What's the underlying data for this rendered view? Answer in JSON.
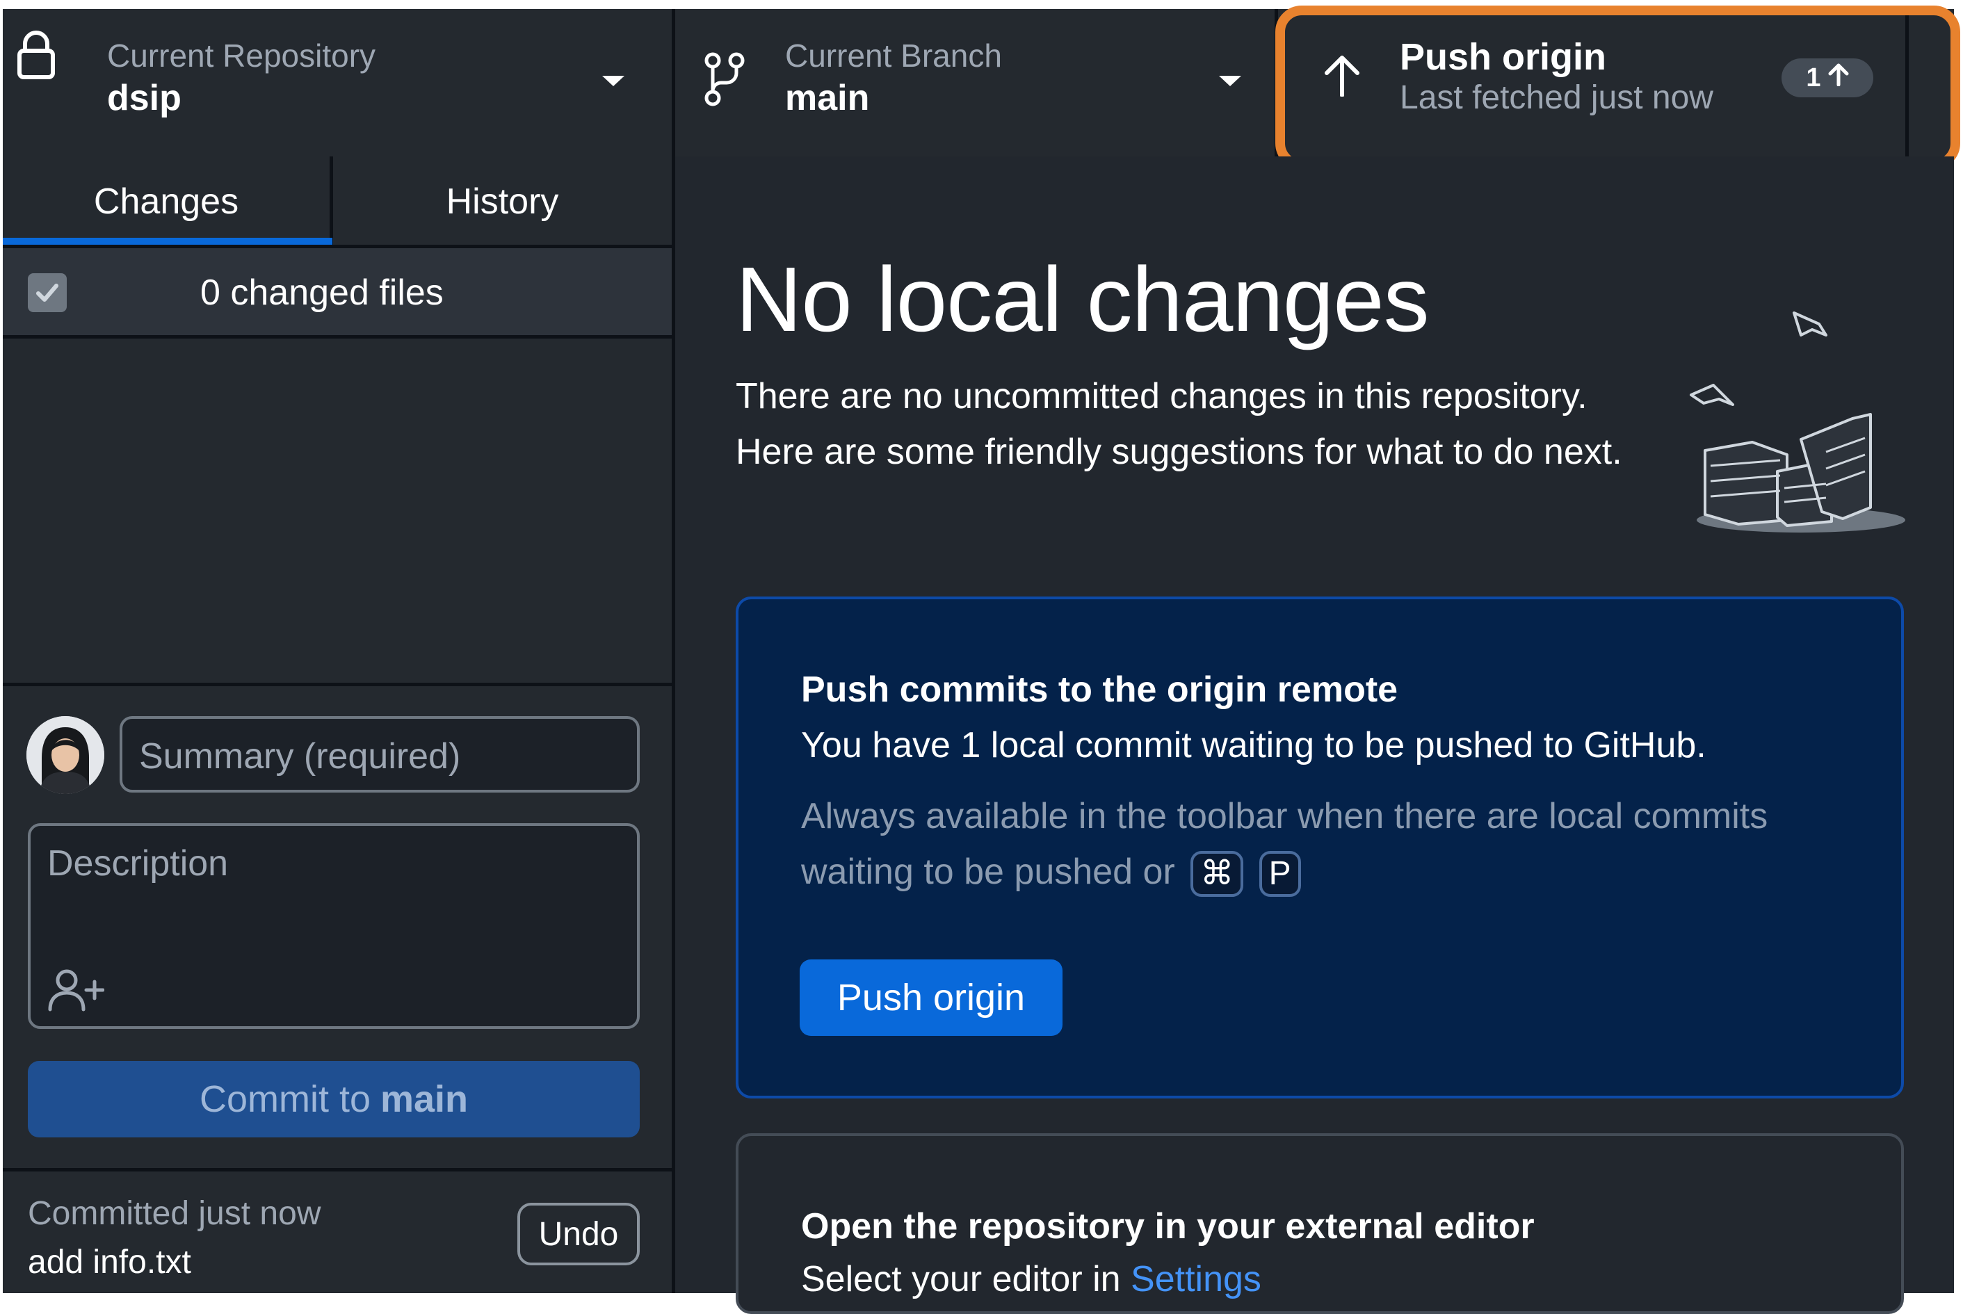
{
  "toolbar": {
    "repository": {
      "label": "Current Repository",
      "value": "dsip",
      "icon": "lock-icon"
    },
    "branch": {
      "label": "Current Branch",
      "value": "main",
      "icon": "git-branch-icon"
    },
    "push": {
      "title": "Push origin",
      "subtitle": "Last fetched just now",
      "icon": "arrow-up-icon",
      "badge_count": "1",
      "highlight_color": "#e8822e"
    }
  },
  "sidebar": {
    "tabs": [
      {
        "label": "Changes",
        "selected": true
      },
      {
        "label": "History",
        "selected": false
      }
    ],
    "changed_files_label": "0 changed files",
    "commit": {
      "summary_placeholder": "Summary (required)",
      "description_placeholder": "Description",
      "button_prefix": "Commit to",
      "button_branch": "main"
    },
    "last_commit": {
      "status": "Committed just now",
      "message": "add info.txt",
      "undo_label": "Undo"
    }
  },
  "main": {
    "title": "No local changes",
    "description": "There are no uncommitted changes in this repository. Here are some friendly suggestions for what to do next.",
    "push_card": {
      "title": "Push commits to the origin remote",
      "text": "You have 1 local commit waiting to be pushed to GitHub.",
      "hint": "Always available in the toolbar when there are local commits waiting to be pushed or",
      "shortcut_keys": [
        "⌘",
        "P"
      ],
      "button_label": "Push origin"
    },
    "editor_card": {
      "title": "Open the repository in your external editor",
      "text_prefix": "Select your editor in",
      "link_label": "Settings"
    }
  },
  "colors": {
    "accent": "#0969da",
    "toolbar_bg": "#24292f",
    "push_card_bg": "#04224a"
  }
}
